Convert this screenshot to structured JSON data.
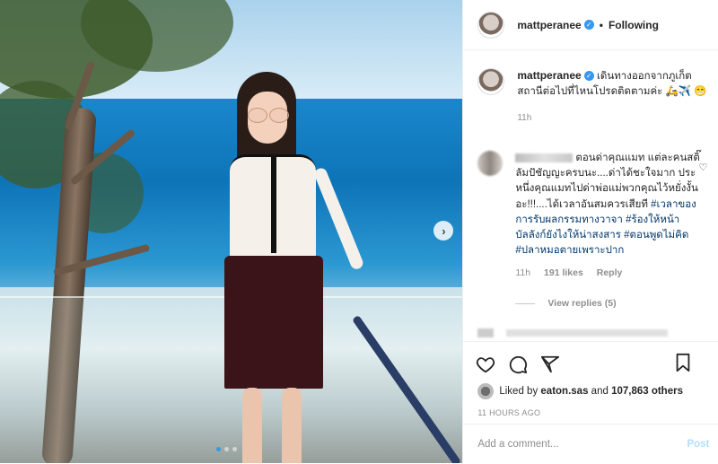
{
  "post": {
    "username": "mattperanee",
    "verified_icon": "verified-badge-icon",
    "follow_separator": "•",
    "follow_label": "Following",
    "caption": {
      "username": "mattperanee",
      "text": "เดินทางออกจากภูเก็ต สถานีต่อไปที่ไหนโปรดติดตามค่ะ 🛵✈️ 😁",
      "time": "11h"
    },
    "comment": {
      "text_before": "ตอนด่าคุณแมท แต่ละคนสติ๊ลัมปัชัญญะครบนะ....ด่าได้ชะใจมาก ประหนึ่งคุณแมทไปด่าพ่อแม่พวกคุณไว้หยั่งงั้นอะ!!!....ได้เวลาอันสมควรเสียที ",
      "hashtags": "#เวลาของการรับผลกรรมทางวาจา #ร้องให้หน้าบัลลังก์ยังไงให้น่าสงสาร #ตอนพูดไม่คิด #ปลาหมอตายเพราะปาก",
      "time": "11h",
      "likes": "191 likes",
      "reply_label": "Reply",
      "view_replies": "View replies (5)"
    },
    "liked_by": {
      "prefix": "Liked by ",
      "user": "eaton.sas",
      "middle": " and ",
      "count": "107,863 others"
    },
    "date": "11 HOURS AGO",
    "add_comment_placeholder": "Add a comment...",
    "post_label": "Post",
    "carousel": {
      "total": 3,
      "active_index": 1
    },
    "colors": {
      "accent": "#3897f0",
      "post_btn_disabled": "#b2dffc",
      "hashtag": "#00376b"
    }
  }
}
